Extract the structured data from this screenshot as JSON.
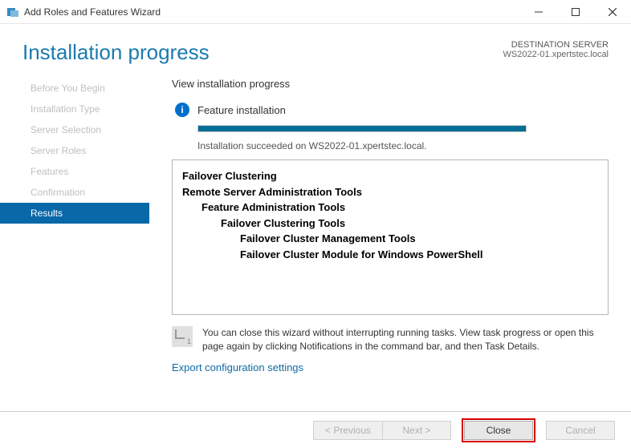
{
  "window": {
    "title": "Add Roles and Features Wizard"
  },
  "header": {
    "pageTitle": "Installation progress",
    "destLabel": "DESTINATION SERVER",
    "destServer": "WS2022-01.xpertstec.local"
  },
  "sidebar": {
    "steps": [
      "Before You Begin",
      "Installation Type",
      "Server Selection",
      "Server Roles",
      "Features",
      "Confirmation",
      "Results"
    ]
  },
  "content": {
    "subtitle": "View installation progress",
    "statusLabel": "Feature installation",
    "succeedText": "Installation succeeded on WS2022-01.xpertstec.local.",
    "features": {
      "lvl0": "Failover Clustering",
      "lvl1": "Remote Server Administration Tools",
      "lvl2": "Feature Administration Tools",
      "lvl3": "Failover Clustering Tools",
      "lvl4a": "Failover Cluster Management Tools",
      "lvl4b": "Failover Cluster Module for Windows PowerShell"
    },
    "noteBadge": "1",
    "note": "You can close this wizard without interrupting running tasks. View task progress or open this page again by clicking Notifications in the command bar, and then Task Details.",
    "exportLink": "Export configuration settings"
  },
  "footer": {
    "previous": "< Previous",
    "next": "Next >",
    "close": "Close",
    "cancel": "Cancel"
  }
}
